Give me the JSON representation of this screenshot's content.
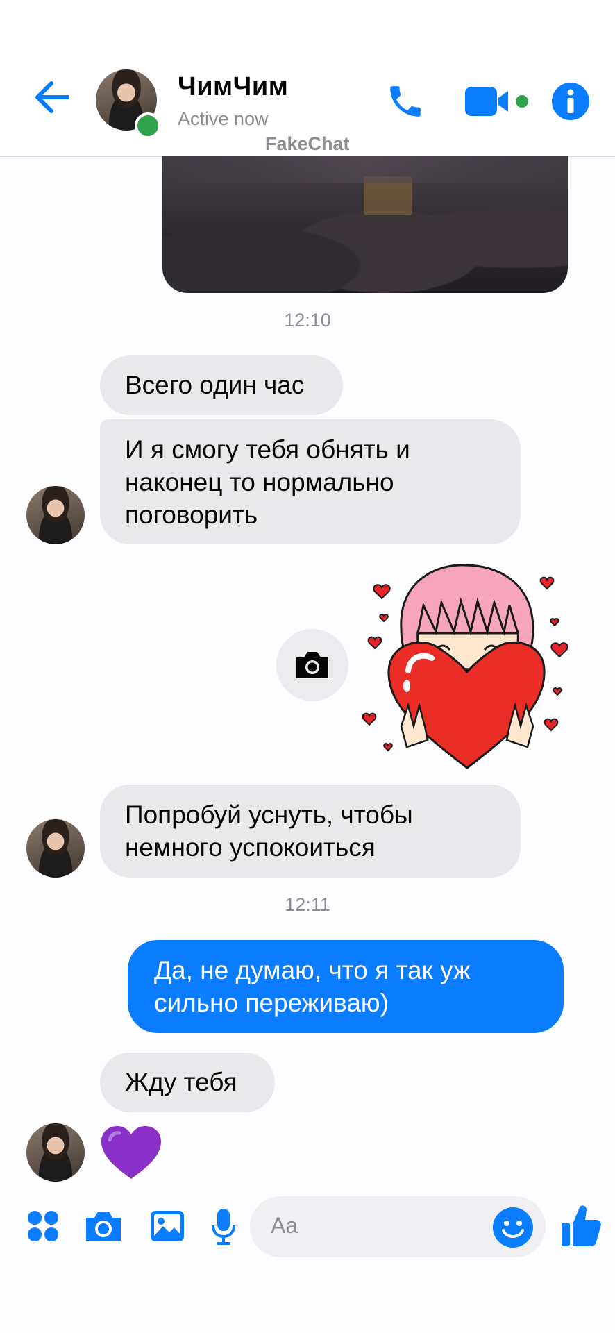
{
  "header": {
    "contact_name": "ЧимЧим",
    "status": "Active now",
    "watermark": "FakeChat",
    "icons": [
      "back-arrow-icon",
      "phone-icon",
      "video-camera-icon",
      "info-icon"
    ],
    "accent_color": "#0a7cff",
    "online_color": "#31a24c"
  },
  "messages": {
    "time_1": "12:10",
    "in_1": "Всего один час",
    "in_2_line1": "И я смогу тебя обнять и",
    "in_2_line2": "наконец то нормально",
    "in_2_line3": "поговорить",
    "in_3_line1": "Попробуй уснуть, чтобы",
    "in_3_line2": "немного успокоиться",
    "time_2": "12:11",
    "out_1_line1": "Да, не думаю, что я так уж",
    "out_1_line2": "сильно переживаю)",
    "in_4": "Жду тебя",
    "emoji": "purple-heart",
    "sticker": "girl-hugging-heart-sticker"
  },
  "composer": {
    "placeholder": "Aa",
    "icons": [
      "apps-icon",
      "camera-icon",
      "gallery-icon",
      "microphone-icon",
      "emoji-icon",
      "thumbs-up-icon"
    ]
  },
  "colors": {
    "incoming_bubble": "#e9e9eb",
    "outgoing_bubble": "#0a7cff",
    "emoji_heart": "#8a2fc8"
  }
}
